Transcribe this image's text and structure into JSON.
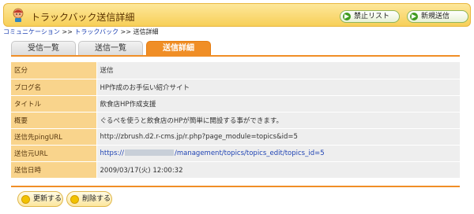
{
  "header": {
    "title": "トラックバック送信詳細",
    "blocklist_label": "禁止リスト",
    "newsend_label": "新規送信"
  },
  "breadcrumb": {
    "items": [
      "コミュニケーション",
      "トラックバック",
      "送信詳細"
    ],
    "separator": ">>"
  },
  "tabs": [
    {
      "label": "受信一覧"
    },
    {
      "label": "送信一覧"
    },
    {
      "label": "送信詳細",
      "active": true
    }
  ],
  "detail": {
    "rows": [
      {
        "label": "区分",
        "value": "送信"
      },
      {
        "label": "ブログ名",
        "value": "HP作成のお手伝い紹介サイト"
      },
      {
        "label": "タイトル",
        "value": "飲食店HP作成支援"
      },
      {
        "label": "概要",
        "value": "ぐるぺを使うと飲食店のHPが簡単に開設する事ができます。"
      },
      {
        "label": "送信先pingURL",
        "value": "http://zbrush.d2.r-cms.jp/r.php?page_module=topics&id=5"
      },
      {
        "label": "送信元URL",
        "value_prefix": "https://",
        "value_suffix": "/management/topics/topics_edit/topics_id=5"
      },
      {
        "label": "送信日時",
        "value": "2009/03/17(火) 12:00:32"
      }
    ]
  },
  "footer": {
    "update_label": "更新する",
    "delete_label": "削除する"
  },
  "colors": {
    "accent": "#f08e26",
    "label_bg": "#f9d48c",
    "value_bg": "#eeeeee",
    "link": "#1f43b3",
    "header_bg": "#f7cf58"
  }
}
